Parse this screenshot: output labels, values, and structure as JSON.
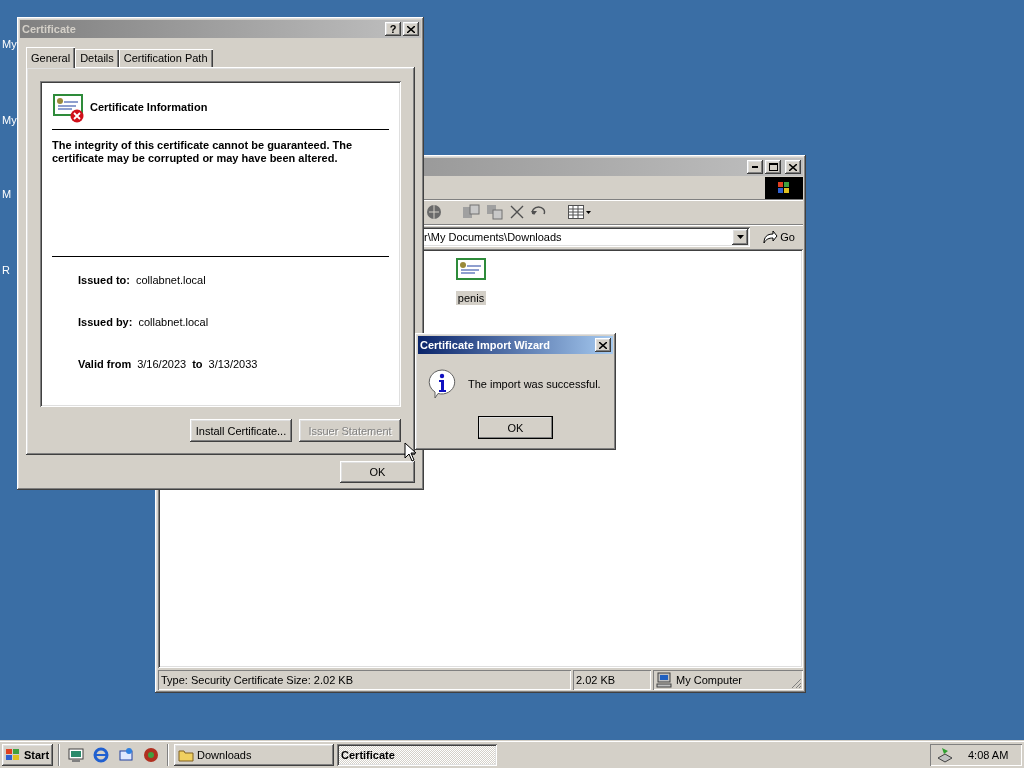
{
  "desktop_icons": [
    {
      "label": "My"
    },
    {
      "label": "My"
    },
    {
      "label": "M"
    },
    {
      "label": "R"
    }
  ],
  "explorer": {
    "active": false,
    "address": "r\\My Documents\\Downloads",
    "go_button": "Go",
    "files": [
      {
        "name": "penis",
        "selected": true
      }
    ],
    "status_bar": {
      "type_info": "Type: Security Certificate Size: 2.02 KB",
      "size": "2.02 KB",
      "zone": "My Computer"
    }
  },
  "certificate_dialog": {
    "title": "Certificate",
    "active": false,
    "help_button": "?",
    "tabs": [
      {
        "label": "General",
        "selected": true
      },
      {
        "label": "Details",
        "selected": false
      },
      {
        "label": "Certification Path",
        "selected": false
      }
    ],
    "heading": "Certificate Information",
    "message": "The integrity of this certificate cannot be guaranteed. The certificate may be corrupted or may have been altered.",
    "fields": [
      {
        "label": "Issued to:",
        "value": "collabnet.local"
      },
      {
        "label": "Issued by:",
        "value": "collabnet.local"
      }
    ],
    "validity": {
      "label": "Valid from",
      "from": "3/16/2023",
      "to_label": "to",
      "to": "3/13/2033"
    },
    "buttons": [
      {
        "label": "Install Certificate...",
        "disabled": false
      },
      {
        "label": "Issuer Statement",
        "disabled": true
      }
    ],
    "ok_button": "OK"
  },
  "wizard_dialog": {
    "title": "Certificate Import Wizard",
    "active": true,
    "message": "The import was successful.",
    "ok_button": "OK"
  },
  "taskbar": {
    "start": "Start",
    "tasks": [
      {
        "label": "Downloads",
        "selected": false
      },
      {
        "label": "Certificate",
        "selected": true
      }
    ],
    "clock": "4:08 AM"
  }
}
